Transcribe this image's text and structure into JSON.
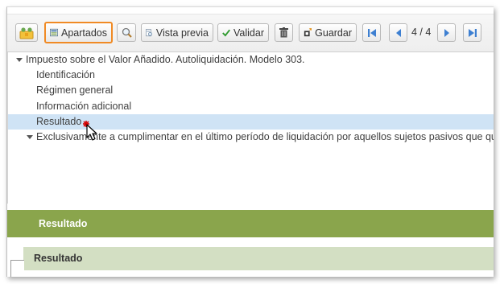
{
  "toolbar": {
    "buttons": {
      "apartados": "Apartados",
      "vista_previa": "Vista previa",
      "validar": "Validar",
      "guardar": "Guardar"
    },
    "pager": "4 / 4"
  },
  "tree": {
    "root": "Impuesto sobre el Valor Añadido. Autoliquidación. Modelo 303.",
    "items": [
      "Identificación",
      "Régimen general",
      "Información adicional",
      "Resultado"
    ],
    "second_root": "Exclusivamente a cumplimentar en el último período de liquidación por aquellos sujetos pasivos que quede"
  },
  "sections": {
    "primary": "Resultado",
    "secondary": "Resultado"
  },
  "colors": {
    "section_green": "#8aa54c",
    "section_light": "#d3dfc3",
    "selected_row": "#cfe3f5",
    "highlight_border": "#f08a24"
  }
}
